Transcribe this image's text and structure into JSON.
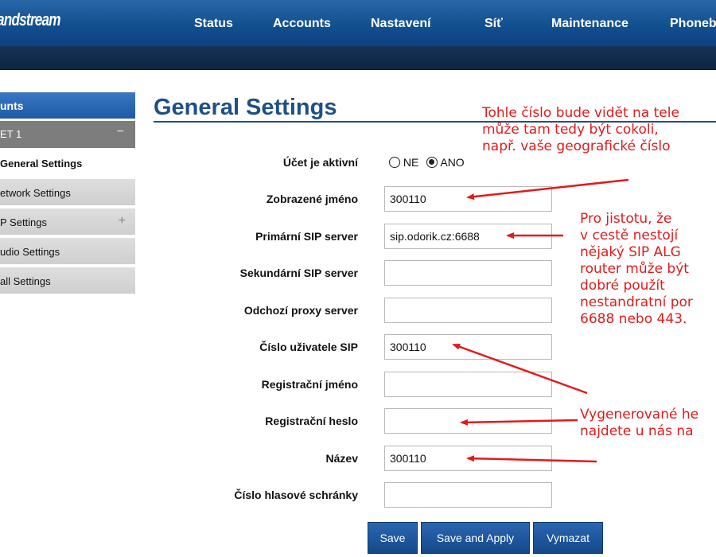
{
  "header": {
    "logo": "andstream",
    "nav": [
      "Status",
      "Accounts",
      "Nastavení",
      "Síť",
      "Maintenance",
      "Phoneb"
    ]
  },
  "sidebar": {
    "section": "unts",
    "account": "ET 1",
    "account_toggle": "−",
    "items": [
      {
        "label": "General Settings"
      },
      {
        "label": "etwork Settings"
      },
      {
        "label": "P Settings"
      },
      {
        "label": "udio Settings"
      },
      {
        "label": "all Settings"
      }
    ],
    "expand_symbol": "+"
  },
  "main": {
    "title": "General Settings",
    "active_label": "Účet je aktivní",
    "radio_no": "NE",
    "radio_yes": "ANO",
    "fields": [
      {
        "label": "Zobrazené jméno",
        "value": "300110"
      },
      {
        "label": "Primární SIP server",
        "value": "sip.odorik.cz:6688"
      },
      {
        "label": "Sekundární SIP server",
        "value": ""
      },
      {
        "label": "Odchozí proxy server",
        "value": ""
      },
      {
        "label": "Číslo uživatele SIP",
        "value": "300110"
      },
      {
        "label": "Registrační jméno",
        "value": ""
      },
      {
        "label": "Registrační heslo",
        "value": ""
      },
      {
        "label": "Název",
        "value": "300110"
      },
      {
        "label": "Číslo hlasové schránky",
        "value": ""
      }
    ],
    "buttons": {
      "save": "Save",
      "save_apply": "Save and Apply",
      "clear": "Vymazat"
    }
  },
  "annotations": {
    "color": "#e11b1b",
    "note1": [
      "Tohle číslo bude vidět na tele",
      "může tam tedy být cokoli,",
      "např. vaše geografické číslo"
    ],
    "note2": [
      "Pro jistotu, že",
      "v cestě nestojí",
      "nějaký SIP ALG",
      "router může být",
      "dobré použít",
      "nestandratní por",
      "6688 nebo 443."
    ],
    "note3": [
      "Vygenerované he",
      "najdete u nás na"
    ]
  }
}
